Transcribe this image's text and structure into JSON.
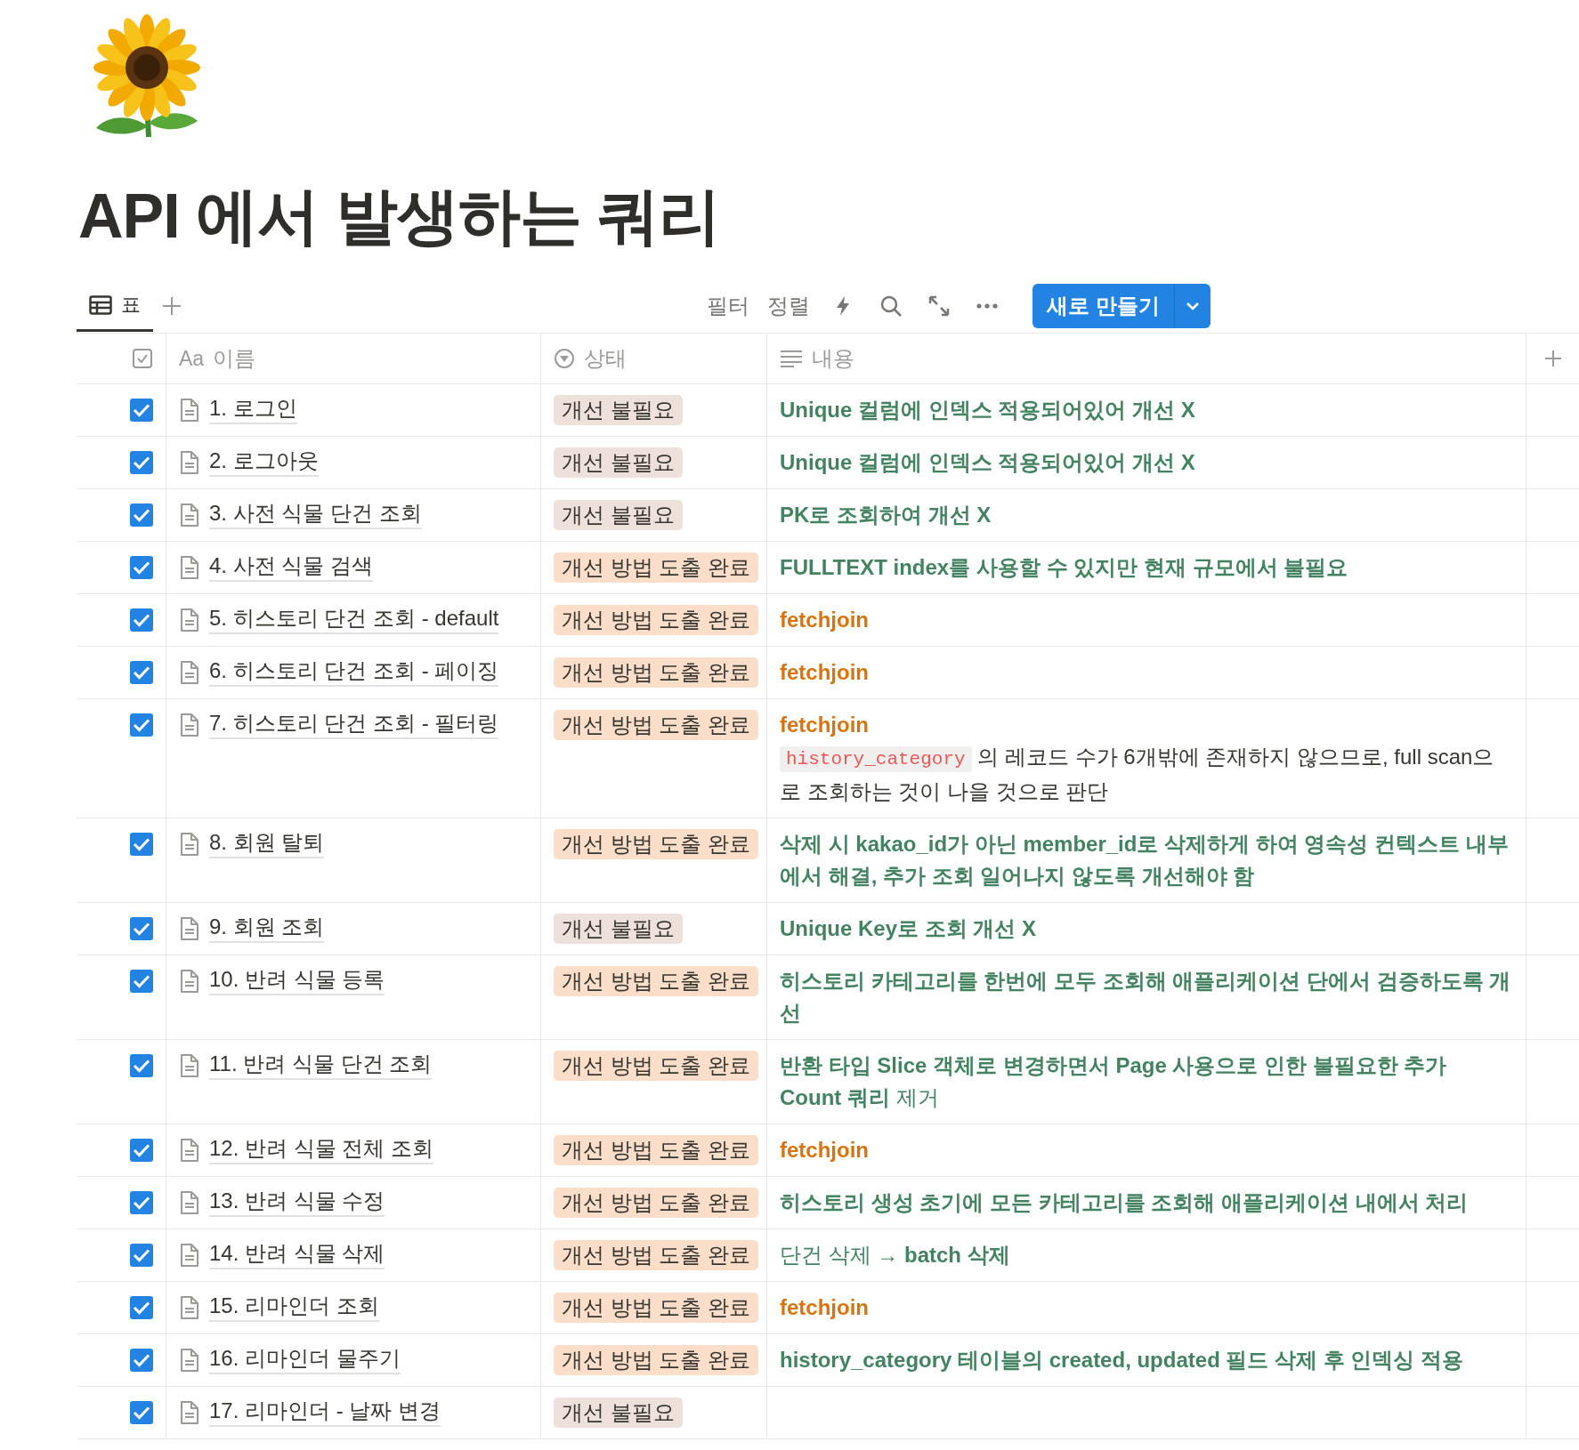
{
  "page": {
    "title": "API 에서 발생하는 쿼리"
  },
  "views": [
    {
      "label": "표",
      "selected": true
    }
  ],
  "toolbar": {
    "filter": "필터",
    "sort": "정렬",
    "new_button": "새로 만들기"
  },
  "table": {
    "columns": [
      {
        "kind": "checkbox"
      },
      {
        "kind": "title",
        "icon_text": "Aa",
        "label": "이름"
      },
      {
        "kind": "select",
        "label": "상태"
      },
      {
        "kind": "text",
        "label": "내용"
      }
    ],
    "rows": [
      {
        "checked": true,
        "name": "1. 로그인",
        "status": {
          "label": "개선 불필요",
          "color": "#eee0da"
        },
        "content": [
          {
            "color": "#448361",
            "bold": true,
            "text": "Unique 컬럼에 인덱스 적용되어있어 개선 X"
          }
        ]
      },
      {
        "checked": true,
        "name": "2. 로그아웃",
        "status": {
          "label": "개선 불필요",
          "color": "#eee0da"
        },
        "content": [
          {
            "color": "#448361",
            "bold": true,
            "text": "Unique 컬럼에 인덱스 적용되어있어 개선 X"
          }
        ]
      },
      {
        "checked": true,
        "name": "3. 사전 식물 단건 조회",
        "status": {
          "label": "개선 불필요",
          "color": "#eee0da"
        },
        "content": [
          {
            "color": "#448361",
            "bold": true,
            "text": "PK로 조회하여 개선 X"
          }
        ]
      },
      {
        "checked": true,
        "name": "4. 사전 식물 검색",
        "status": {
          "label": "개선 방법 도출 완료",
          "color": "#fadec9"
        },
        "content": [
          {
            "color": "#448361",
            "bold": true,
            "text": "FULLTEXT index를 사용할 수 있지만 현재 규모에서 불필요"
          }
        ]
      },
      {
        "checked": true,
        "name": "5. 히스토리 단건 조회 - default",
        "status": {
          "label": "개선 방법 도출 완료",
          "color": "#fadec9"
        },
        "content": [
          {
            "color": "#d9730d",
            "bold": true,
            "text": "fetchjoin"
          }
        ]
      },
      {
        "checked": true,
        "name": "6. 히스토리 단건 조회 - 페이징",
        "status": {
          "label": "개선 방법 도출 완료",
          "color": "#fadec9"
        },
        "content": [
          {
            "color": "#d9730d",
            "bold": true,
            "text": "fetchjoin"
          }
        ]
      },
      {
        "checked": true,
        "name": "7. 히스토리 단건 조회 - 필터링",
        "status": {
          "label": "개선 방법 도출 완료",
          "color": "#fadec9"
        },
        "content": [
          {
            "color": "#d9730d",
            "bold": true,
            "text": "fetchjoin"
          },
          {
            "color": "#37352f",
            "bold": false,
            "code": "history_category",
            "text": " 의 레코드 수가 6개밖에 존재하지 않으므로, full scan으로 조회하는 것이 나을 것으로 판단"
          }
        ]
      },
      {
        "checked": true,
        "name": "8. 회원 탈퇴",
        "status": {
          "label": "개선 방법 도출 완료",
          "color": "#fadec9"
        },
        "content": [
          {
            "color": "#448361",
            "bold": true,
            "text": "삭제 시 kakao_id가 아닌 member_id로 삭제하게 하여 영속성 컨텍스트 내부에서 해결, 추가 조회 일어나지 않도록 개선해야 함"
          }
        ]
      },
      {
        "checked": true,
        "name": "9. 회원 조회",
        "status": {
          "label": "개선 불필요",
          "color": "#eee0da"
        },
        "content": [
          {
            "color": "#448361",
            "bold": true,
            "text": "Unique Key로 조회 개선 X"
          }
        ]
      },
      {
        "checked": true,
        "name": "10. 반려 식물 등록",
        "status": {
          "label": "개선 방법 도출 완료",
          "color": "#fadec9"
        },
        "content": [
          {
            "color": "#448361",
            "bold": true,
            "text": "히스토리 카테고리를 한번에 모두 조회해 애플리케이션 단에서 검증하도록 개선"
          }
        ]
      },
      {
        "checked": true,
        "name": "11. 반려 식물 단건 조회",
        "status": {
          "label": "개선 방법 도출 완료",
          "color": "#fadec9"
        },
        "content": [
          {
            "color": "#448361",
            "bold": false,
            "text": "**반환 타입 Slice 객체로 변경하면서 Page 사용으로 인한 불필요한 추가 Count 쿼리** 제거"
          }
        ]
      },
      {
        "checked": true,
        "name": "12. 반려 식물 전체 조회",
        "status": {
          "label": "개선 방법 도출 완료",
          "color": "#fadec9"
        },
        "content": [
          {
            "color": "#d9730d",
            "bold": true,
            "text": "fetchjoin"
          }
        ]
      },
      {
        "checked": true,
        "name": "13. 반려 식물 수정",
        "status": {
          "label": "개선 방법 도출 완료",
          "color": "#fadec9"
        },
        "content": [
          {
            "color": "#448361",
            "bold": true,
            "text": "히스토리 생성 초기에 모든 카테고리를 조회해 애플리케이션 내에서 처리"
          }
        ]
      },
      {
        "checked": true,
        "name": "14. 반려 식물 삭제",
        "status": {
          "label": "개선 방법 도출 완료",
          "color": "#fadec9"
        },
        "content": [
          {
            "color": "#448361",
            "bold": false,
            "text": "단건 삭제 → **batch 삭제**"
          }
        ]
      },
      {
        "checked": true,
        "name": "15. 리마인더 조회",
        "status": {
          "label": "개선 방법 도출 완료",
          "color": "#fadec9"
        },
        "content": [
          {
            "color": "#d9730d",
            "bold": true,
            "text": "fetchjoin"
          }
        ]
      },
      {
        "checked": true,
        "name": "16. 리마인더 물주기",
        "status": {
          "label": "개선 방법 도출 완료",
          "color": "#fadec9"
        },
        "content": [
          {
            "color": "#448361",
            "bold": true,
            "text": "history_category 테이블의 created, updated 필드 삭제 후 인덱싱 적용"
          }
        ]
      },
      {
        "checked": true,
        "name": "17. 리마인더 - 날짜 변경",
        "status": {
          "label": "개선 불필요",
          "color": "#eee0da"
        },
        "content": []
      }
    ]
  }
}
